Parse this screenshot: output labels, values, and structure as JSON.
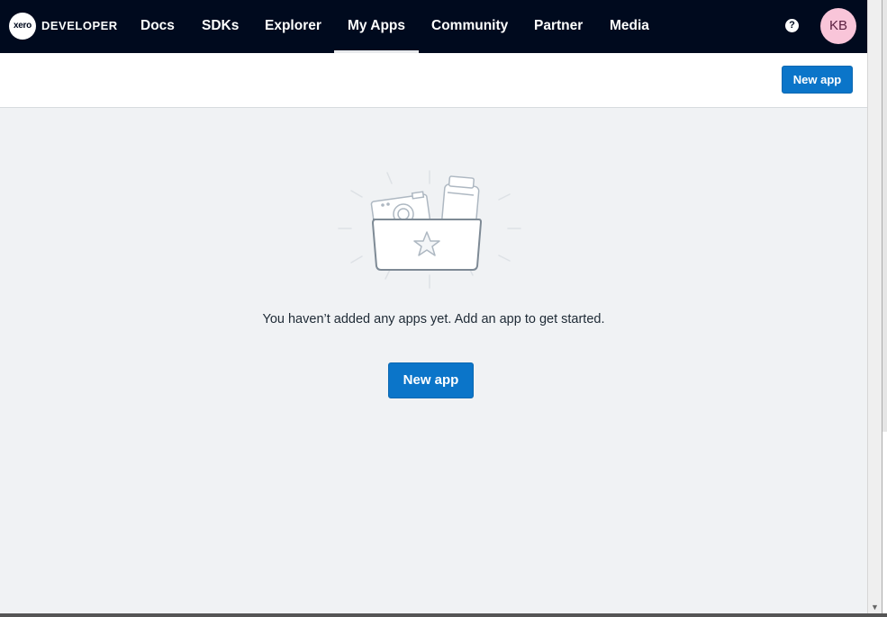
{
  "nav": {
    "logo_badge": "xero",
    "logo_text": "DEVELOPER",
    "items": [
      {
        "label": "Docs"
      },
      {
        "label": "SDKs"
      },
      {
        "label": "Explorer"
      },
      {
        "label": "My Apps"
      },
      {
        "label": "Community"
      },
      {
        "label": "Partner"
      },
      {
        "label": "Media"
      }
    ],
    "active_item": "My Apps",
    "help_icon": "?",
    "avatar_initials": "KB"
  },
  "subheader": {
    "new_app_label": "New app"
  },
  "empty_state": {
    "illustration": "folder-with-camera-and-jar-and-star-icon",
    "message": "You haven’t added any apps yet. Add an app to get started.",
    "new_app_label": "New app"
  },
  "colors": {
    "nav_bg": "#000a1e",
    "accent": "#0b75c9",
    "page_bg": "#f0f2f4",
    "avatar_bg": "#f9c5d9"
  }
}
